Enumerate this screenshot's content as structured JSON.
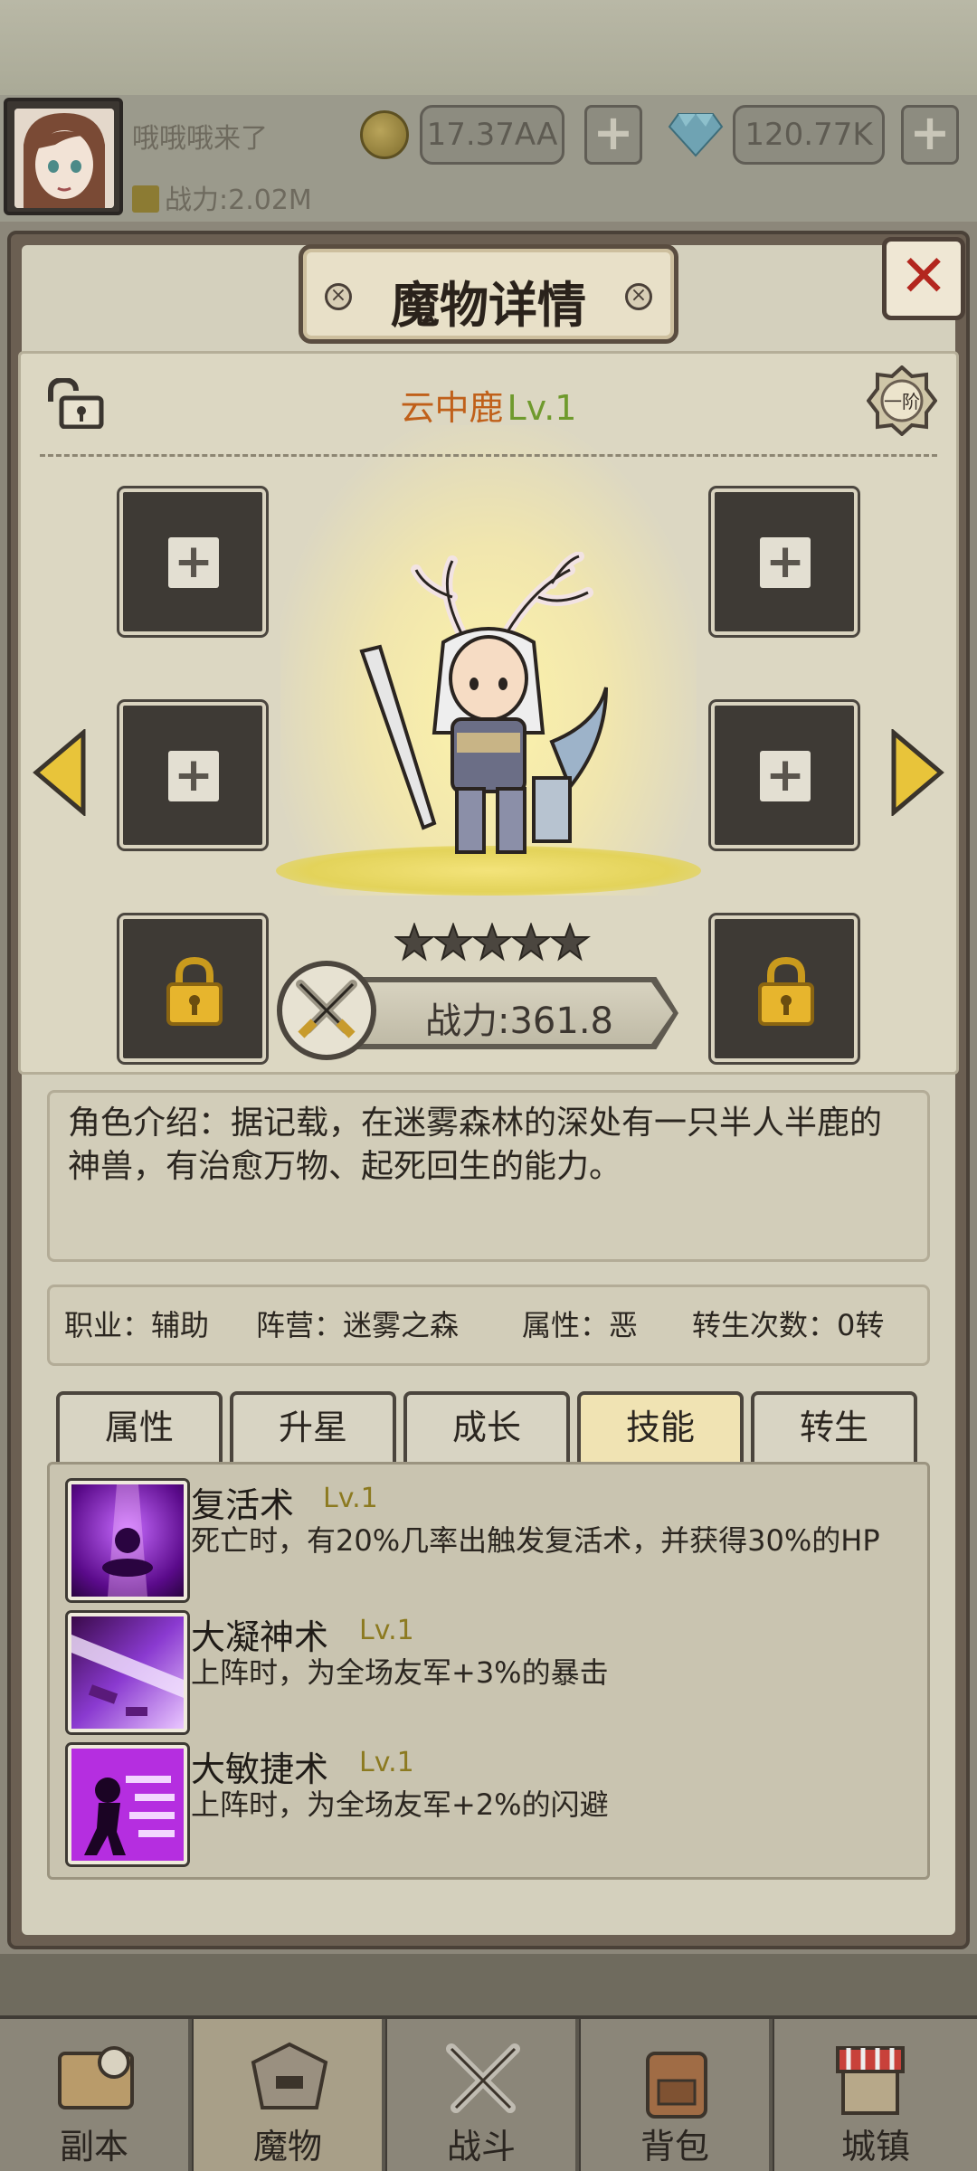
{
  "player": {
    "name": "哦哦哦来了",
    "power": "战力:2.02M"
  },
  "currency": {
    "gold": "17.37AA",
    "diamonds": "120.77K"
  },
  "panel": {
    "title": "魔物详情",
    "close_label": "✕"
  },
  "monster": {
    "name": "云中鹿",
    "level": "Lv.1",
    "tier": "一阶",
    "stars": 5,
    "power": "战力:361.8",
    "description": "角色介绍：据记载，在迷雾森林的深处有一只半人半鹿的神兽，有治愈万物、起死回生的能力。",
    "info": {
      "job": "职业：辅助",
      "camp": "阵营：迷雾之森",
      "attribute": "属性：恶",
      "rebirth": "转生次数：0转"
    }
  },
  "tabs": [
    {
      "label": "属性"
    },
    {
      "label": "升星"
    },
    {
      "label": "成长"
    },
    {
      "label": "技能"
    },
    {
      "label": "转生"
    }
  ],
  "active_tab": "技能",
  "skills": [
    {
      "name": "复活术",
      "level": "Lv.1",
      "desc": "死亡时，有20%几率出触发复活术，并获得30%的HP"
    },
    {
      "name": "大凝神术",
      "level": "Lv.1",
      "desc": "上阵时，为全场友军+3%的暴击"
    },
    {
      "name": "大敏捷术",
      "level": "Lv.1",
      "desc": "上阵时，为全场友军+2%的闪避"
    }
  ],
  "nav": [
    {
      "label": "副本",
      "icon": "map-icon"
    },
    {
      "label": "魔物",
      "icon": "monster-helmet-icon"
    },
    {
      "label": "战斗",
      "icon": "crossed-swords-icon"
    },
    {
      "label": "背包",
      "icon": "backpack-icon"
    },
    {
      "label": "城镇",
      "icon": "shop-icon"
    }
  ],
  "colors": {
    "accent_gold": "#f0e3b3",
    "name_orange": "#c0601a",
    "level_green": "#6f9a2d",
    "close_red": "#b3261e"
  }
}
